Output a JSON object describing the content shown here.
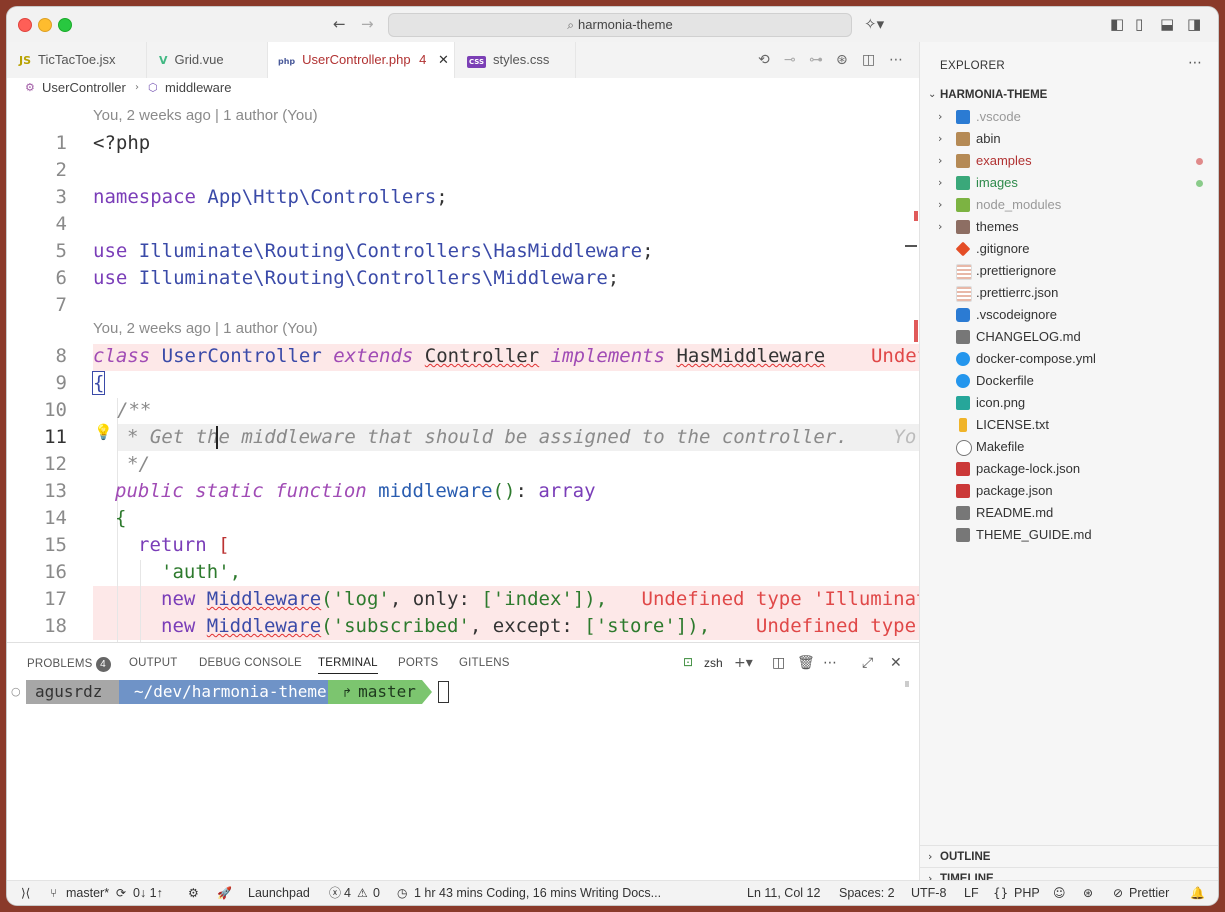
{
  "window": {
    "title": "harmonia-theme"
  },
  "tabs": [
    {
      "icon": "JS",
      "label": "TicTacToe.jsx"
    },
    {
      "icon": "V",
      "label": "Grid.vue"
    },
    {
      "icon": "php",
      "label": "UserController.php",
      "badge": "4"
    },
    {
      "icon": "CSS",
      "label": "styles.css"
    }
  ],
  "breadcrumb": {
    "item1": "UserController",
    "item2": "middleware"
  },
  "editor": {
    "blame1": "You, 2 weeks ago | 1 author (You)",
    "blame2": "You, 2 weeks ago | 1 author (You)",
    "line_numbers": [
      "1",
      "2",
      "3",
      "4",
      "5",
      "6",
      "7",
      "8",
      "9",
      "10",
      "11",
      "12",
      "13",
      "14",
      "15",
      "16",
      "17",
      "18"
    ],
    "l1": "<?php",
    "l3_kw": "namespace",
    "l3_ns": "App\\Http\\Controllers",
    "l3_end": ";",
    "l5_kw": "use",
    "l5_ns": "Illuminate\\Routing\\Controllers\\HasMiddleware",
    "l5_end": ";",
    "l6_kw": "use",
    "l6_ns": "Illuminate\\Routing\\Controllers\\Middleware",
    "l6_end": ";",
    "l8_class": "class",
    "l8_name": "UserController",
    "l8_extends": "extends",
    "l8_parent": "Controller",
    "l8_impl": "implements",
    "l8_iface": "HasMiddleware",
    "l8_err": "Undefi",
    "l9": "{",
    "l10": "/**",
    "l11": "* Get the middleware that should be assigned to the controller.",
    "l11_ghost": "Yo",
    "l12": "*/",
    "l13_pub": "public",
    "l13_static": "static",
    "l13_fn": "function",
    "l13_name": "middleware",
    "l13_paren": "()",
    "l13_colon": ": ",
    "l13_type": "array",
    "l14": "{",
    "l15_ret": "return",
    "l15_br": "[",
    "l16": "'auth',",
    "l17_new": "new",
    "l17_cls": "Middleware",
    "l17_args_a": "(",
    "l17_s1": "'log'",
    "l17_args_b": ", only: ",
    "l17_arr": "['index']",
    "l17_end": "),",
    "l17_err": "Undefined type 'Illuminat",
    "l18_new": "new",
    "l18_cls": "Middleware",
    "l18_args_a": "(",
    "l18_s1": "'subscribed'",
    "l18_args_b": ", except: ",
    "l18_arr": "['store']",
    "l18_end": "),",
    "l18_err": "Undefined type '"
  },
  "panel": {
    "tabs": [
      "PROBLEMS",
      "OUTPUT",
      "DEBUG CONSOLE",
      "TERMINAL",
      "PORTS",
      "GITLENS"
    ],
    "problems_count": "4",
    "shell": "zsh",
    "prompt_user": "agusrdz",
    "prompt_path": "~/dev/harmonia-theme",
    "prompt_branch": "master"
  },
  "explorer": {
    "title": "EXPLORER",
    "root": "HARMONIA-THEME",
    "items": [
      {
        "name": ".vscode",
        "folder": true
      },
      {
        "name": "abin",
        "folder": true
      },
      {
        "name": "examples",
        "folder": true
      },
      {
        "name": "images",
        "folder": true
      },
      {
        "name": "node_modules",
        "folder": true
      },
      {
        "name": "themes",
        "folder": true
      },
      {
        "name": ".gitignore"
      },
      {
        "name": ".prettierignore"
      },
      {
        "name": ".prettierrc.json"
      },
      {
        "name": ".vscodeignore"
      },
      {
        "name": "CHANGELOG.md"
      },
      {
        "name": "docker-compose.yml"
      },
      {
        "name": "Dockerfile"
      },
      {
        "name": "icon.png"
      },
      {
        "name": "LICENSE.txt"
      },
      {
        "name": "Makefile"
      },
      {
        "name": "package-lock.json"
      },
      {
        "name": "package.json"
      },
      {
        "name": "README.md"
      },
      {
        "name": "THEME_GUIDE.md"
      }
    ],
    "outline": "OUTLINE",
    "timeline": "TIMELINE"
  },
  "status": {
    "branch": "master*",
    "sync": "0↓ 1↑",
    "launchpad": "Launchpad",
    "errors": "4",
    "warnings": "0",
    "time": "1 hr 43 mins Coding, 16 mins Writing Docs...",
    "position": "Ln 11, Col 12",
    "spaces": "Spaces: 2",
    "encoding": "UTF-8",
    "eol": "LF",
    "language": "PHP",
    "prettier": "Prettier"
  },
  "colors": {
    "accent_red": "#b13232",
    "error": "#e04848",
    "prompt_gray": "#9a9a9a",
    "prompt_blue": "#6f93c7",
    "prompt_green": "#7cc56f"
  }
}
